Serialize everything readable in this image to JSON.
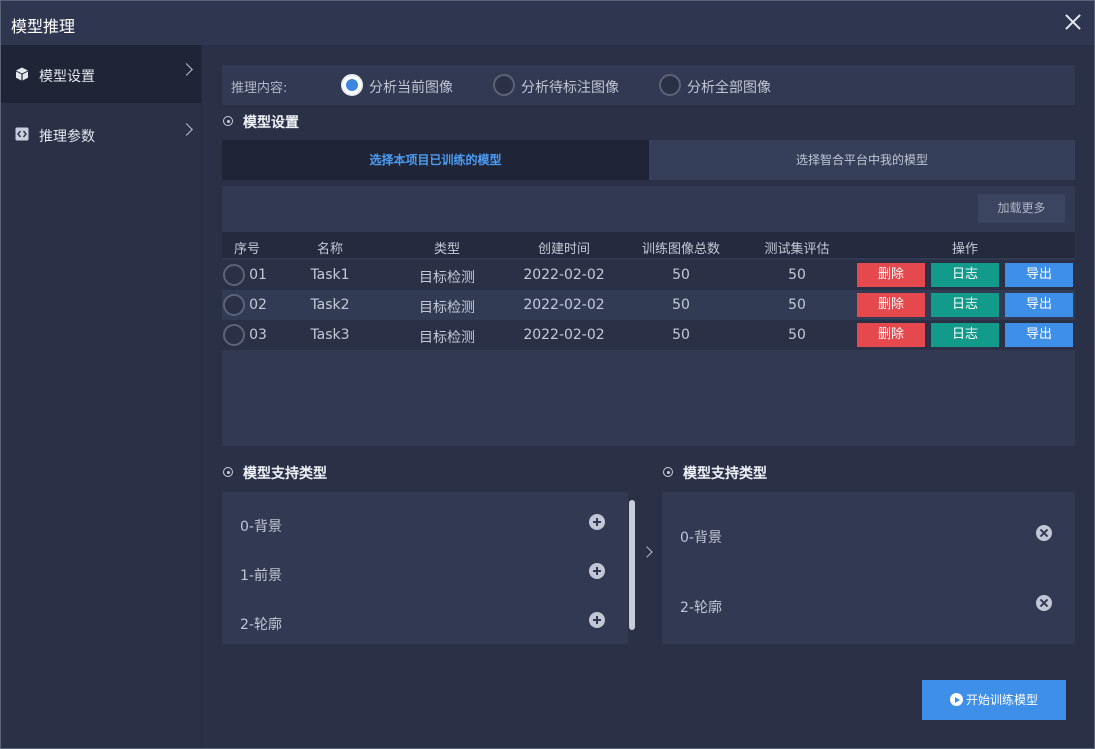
{
  "window": {
    "title": "模型推理"
  },
  "sidebar": {
    "items": [
      {
        "label": "模型设置",
        "icon": "cube-icon",
        "active": true
      },
      {
        "label": "推理参数",
        "icon": "code-icon",
        "active": false
      }
    ]
  },
  "inference": {
    "label": "推理内容:",
    "options": [
      {
        "label": "分析当前图像",
        "checked": true
      },
      {
        "label": "分析待标注图像",
        "checked": false
      },
      {
        "label": "分析全部图像",
        "checked": false
      }
    ]
  },
  "model_settings": {
    "title": "模型设置",
    "tabs": [
      {
        "label": "选择本项目已训练的模型",
        "active": true
      },
      {
        "label": "选择智合平台中我的模型",
        "active": false
      }
    ],
    "load_more": "加载更多",
    "columns": [
      "序号",
      "名称",
      "类型",
      "创建时间",
      "训练图像总数",
      "测试集评估",
      "操作"
    ],
    "rows": [
      {
        "index": "01",
        "name": "Task1",
        "type": "目标检测",
        "created": "2022-02-02",
        "train_total": "50",
        "test_eval": "50"
      },
      {
        "index": "02",
        "name": "Task2",
        "type": "目标检测",
        "created": "2022-02-02",
        "train_total": "50",
        "test_eval": "50"
      },
      {
        "index": "03",
        "name": "Task3",
        "type": "目标检测",
        "created": "2022-02-02",
        "train_total": "50",
        "test_eval": "50"
      }
    ],
    "actions": {
      "delete": "删除",
      "log": "日志",
      "export": "导出"
    }
  },
  "support_left": {
    "title": "模型支持类型",
    "items": [
      "0-背景",
      "1-前景",
      "2-轮廓"
    ]
  },
  "support_right": {
    "title": "模型支持类型",
    "items": [
      "0-背景",
      "2-轮廓"
    ]
  },
  "start_button": {
    "label": "开始训练模型"
  },
  "colors": {
    "accent": "#3d8fe8",
    "danger": "#e5484d",
    "success": "#129a8a",
    "panel": "#313a52",
    "background": "#2a3147"
  }
}
